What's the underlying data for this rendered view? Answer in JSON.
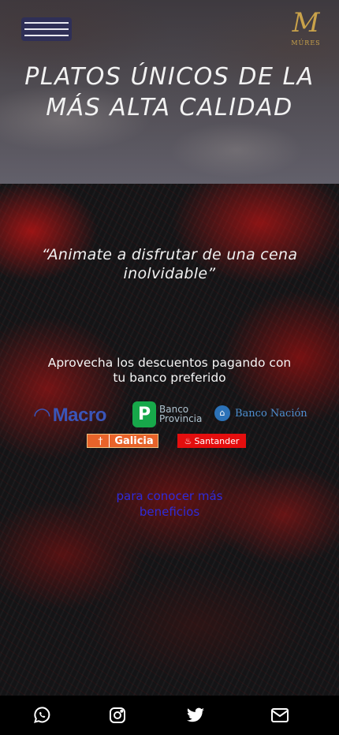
{
  "header": {
    "menu_icon": "hamburger-icon",
    "logo": {
      "monogram": "M",
      "wordmark": "MÚRES"
    }
  },
  "hero": {
    "title": "PLATOS ÚNICOS DE LA MÁS ALTA CALIDAD"
  },
  "main": {
    "quote": "“Animate a disfrutar de una cena inolvidable”",
    "promo_text": "Aprovecha los descuentos pagando con tu banco preferido",
    "banks": [
      {
        "name": "Macro",
        "icon": "macro-logo",
        "color": "#3a55b8"
      },
      {
        "name": "Banco Provincia",
        "icon": "banco-provincia-logo",
        "color": "#17a84a"
      },
      {
        "name": "Banco Nación",
        "icon": "banco-nacion-logo",
        "color": "#2c72b8"
      },
      {
        "name": "Galicia",
        "icon": "galicia-logo",
        "color": "#e8632a"
      },
      {
        "name": "Santander",
        "icon": "santander-logo",
        "color": "#e40e0e"
      }
    ],
    "more_link": "para conocer más beneficios"
  },
  "footer": {
    "social": [
      {
        "name": "whatsapp",
        "icon": "whatsapp-icon"
      },
      {
        "name": "instagram",
        "icon": "instagram-icon"
      },
      {
        "name": "twitter",
        "icon": "twitter-icon"
      },
      {
        "name": "email",
        "icon": "envelope-icon"
      }
    ]
  },
  "colors": {
    "accent_gold": "#c9a24a",
    "link_blue": "#2f2bd8",
    "menu_bg": "#2f2f57",
    "fractal_red": "#c81414"
  }
}
